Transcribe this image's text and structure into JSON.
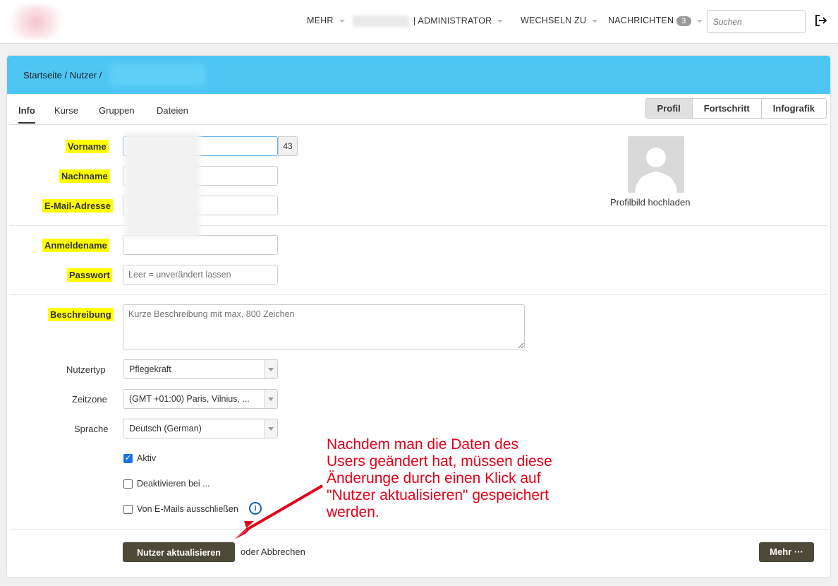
{
  "nav": {
    "more": "MEHR",
    "admin": "| ADMINISTRATOR",
    "switch": "WECHSELN ZU",
    "messages": "NACHRICHTEN",
    "messages_count": "3",
    "search_placeholder": "Suchen"
  },
  "breadcrumb": "Startseite / Nutzer /",
  "tabs": [
    "Info",
    "Kurse",
    "Gruppen",
    "Dateien"
  ],
  "views": [
    "Profil",
    "Fortschritt",
    "Infografik"
  ],
  "form": {
    "first_name": "Vorname",
    "first_name_counter": "43",
    "last_name": "Nachname",
    "email": "E-Mail-Adresse",
    "username": "Anmeldename",
    "password": "Passwort",
    "password_placeholder": "Leer = unverändert lassen",
    "description": "Beschreibung",
    "description_placeholder": "Kurze Beschreibung mit max. 800 Zeichen",
    "user_type_label": "Nutzertyp",
    "user_type_value": "Pflegekraft",
    "timezone_label": "Zeitzone",
    "timezone_value": "(GMT +01:00) Paris, Vilnius, ...",
    "language_label": "Sprache",
    "language_value": "Deutsch (German)",
    "active": "Aktiv",
    "deactivate": "Deaktivieren bei ...",
    "exclude_emails": "Von E-Mails ausschließen"
  },
  "profile_upload": "Profilbild hochladen",
  "actions": {
    "update": "Nutzer aktualisieren",
    "cancel": "oder Abbrechen",
    "more": "Mehr ···"
  },
  "annotation": "Nachdem man die Daten des Users geändert hat, müssen diese Änderunge durch einen Klick auf \"Nutzer aktualisieren\" gespeichert werden.",
  "colors": {
    "header_bg": "#4ec6f4",
    "highlight": "#ffff00",
    "button_bg": "#4d4a3a",
    "annotation": "#e3001b"
  }
}
